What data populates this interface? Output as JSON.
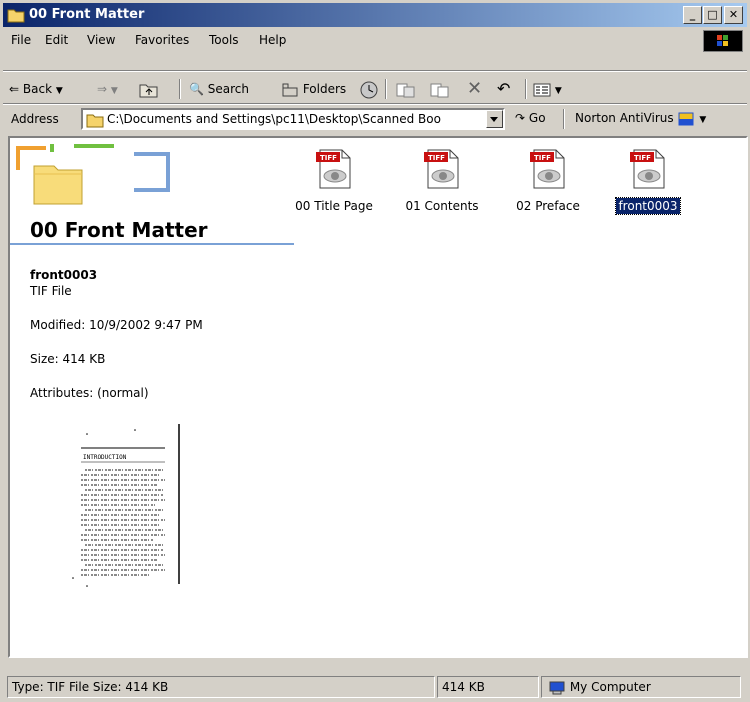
{
  "window": {
    "title": "00 Front Matter"
  },
  "menu": [
    "File",
    "Edit",
    "View",
    "Favorites",
    "Tools",
    "Help"
  ],
  "toolbar": {
    "back": "Back",
    "search": "Search",
    "folders": "Folders"
  },
  "address": {
    "label": "Address",
    "value": "C:\\Documents and Settings\\pc11\\Desktop\\Scanned Boo",
    "go": "Go",
    "norton": "Norton AntiVirus"
  },
  "folder_panel": {
    "title": "00 Front Matter",
    "selected_name": "front0003",
    "selected_type": "TIF File",
    "modified": "Modified: 10/9/2002 9:47 PM",
    "size": "Size: 414 KB",
    "attributes": "Attributes: (normal)",
    "preview_heading": "INTRODUCTION"
  },
  "files": [
    {
      "label": "TIFF",
      "name": "00 Title Page",
      "selected": false
    },
    {
      "label": "TIFF",
      "name": "01 Contents",
      "selected": false
    },
    {
      "label": "TIFF",
      "name": "02 Preface",
      "selected": false
    },
    {
      "label": "TIFF",
      "name": "front0003",
      "selected": true
    }
  ],
  "status": {
    "text": "Type: TIF File Size: 414 KB",
    "size": "414 KB",
    "zone": "My Computer"
  }
}
